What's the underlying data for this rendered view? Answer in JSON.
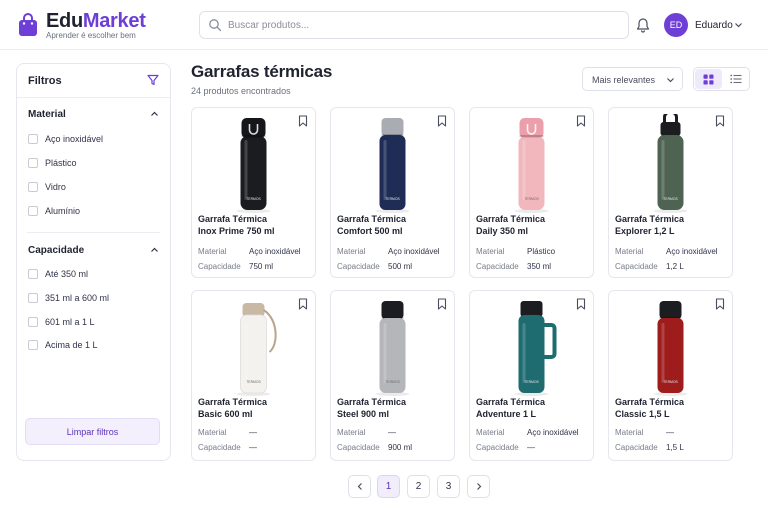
{
  "header": {
    "brand_part1": "Edu",
    "brand_part2": "Market",
    "tagline": "Aprender é escolher bem",
    "search_placeholder": "Buscar produtos...",
    "user_initials": "ED",
    "user_name": "Eduardo"
  },
  "sidebar": {
    "title": "Filtros",
    "sections": [
      {
        "title": "Material",
        "options": [
          "Aço inoxidável",
          "Plástico",
          "Vidro",
          "Alumínio"
        ]
      },
      {
        "title": "Capacidade",
        "options": [
          "Até 350 ml",
          "351 ml a 600 ml",
          "601 ml a 1 L",
          "Acima de 1 L"
        ]
      }
    ],
    "clear_label": "Limpar filtros"
  },
  "main": {
    "title": "Garrafas térmicas",
    "result_count": "24 produtos encontrados",
    "sort_label": "Mais relevantes",
    "attr_labels": {
      "material": "Material",
      "capacity": "Capacidade"
    },
    "products": [
      {
        "name_line1": "Garrafa Térmica",
        "name_line2": "Inox Prime 750 ml",
        "material": "Aço inoxidável",
        "capacity": "750 ml",
        "bottle_color": "#1b1c20",
        "cap_color": "#16171b",
        "shape": "flip",
        "brand_mark": "TERMOS"
      },
      {
        "name_line1": "Garrafa Térmica",
        "name_line2": "Comfort 500 ml",
        "material": "Aço inoxidável",
        "capacity": "500 ml",
        "bottle_color": "#1f2d56",
        "cap_color": "#a9acb3",
        "shape": "classic",
        "brand_mark": "TERMOS"
      },
      {
        "name_line1": "Garrafa Térmica",
        "name_line2": "Daily 350 ml",
        "material": "Plástico",
        "capacity": "350 ml",
        "bottle_color": "#f1b7bd",
        "cap_color": "#ea9faa",
        "shape": "flip",
        "brand_mark": "TERMOS"
      },
      {
        "name_line1": "Garrafa Térmica",
        "name_line2": "Explorer 1,2 L",
        "material": "Aço inoxidável",
        "capacity": "1,2 L",
        "bottle_color": "#4f6352",
        "cap_color": "#1c1d20",
        "shape": "loop",
        "brand_mark": "TERMOS"
      },
      {
        "name_line1": "Garrafa Térmica",
        "name_line2": "Basic 600 ml",
        "material": "—",
        "capacity": "—",
        "bottle_color": "#f3f2ef",
        "cap_color": "#c9b8a4",
        "shape": "strap",
        "brand_mark": "TERMOS"
      },
      {
        "name_line1": "Garrafa Térmica",
        "name_line2": "Steel 900 ml",
        "material": "—",
        "capacity": "900 ml",
        "bottle_color": "#b4b6ba",
        "cap_color": "#1c1d20",
        "shape": "classic",
        "brand_mark": "TERMOS"
      },
      {
        "name_line1": "Garrafa Térmica",
        "name_line2": "Adventure 1 L",
        "material": "Aço inoxidável",
        "capacity": "—",
        "bottle_color": "#1e6b70",
        "cap_color": "#1c1d20",
        "shape": "handle",
        "brand_mark": "TERMOS"
      },
      {
        "name_line1": "Garrafa Térmica",
        "name_line2": "Classic 1,5 L",
        "material": "—",
        "capacity": "1,5 L",
        "bottle_color": "#9e1c1c",
        "cap_color": "#1c1d20",
        "shape": "classic",
        "brand_mark": "TERMOS"
      }
    ]
  },
  "pagination": {
    "pages": [
      "1",
      "2",
      "3"
    ],
    "current": "1"
  },
  "colors": {
    "accent": "#6d3fd6",
    "accent_soft": "#f1edfb"
  },
  "icons": [
    "shopping-bag-icon",
    "search-icon",
    "bell-icon",
    "chevron-down-icon",
    "funnel-icon",
    "chevron-up-icon",
    "bookmark-icon",
    "grid-view-icon",
    "list-view-icon",
    "chevron-left-icon",
    "chevron-right-icon"
  ]
}
